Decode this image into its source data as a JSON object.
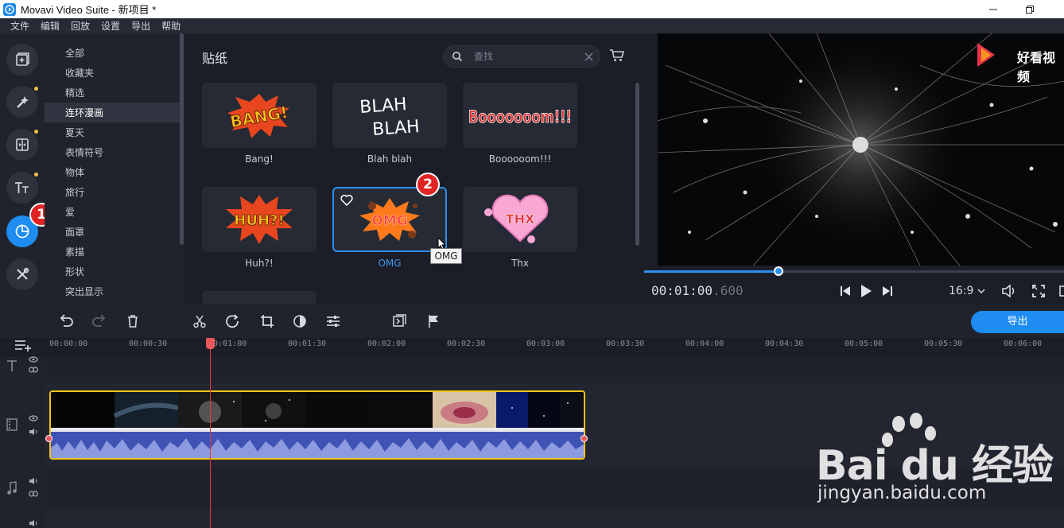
{
  "window": {
    "title": "Movavi Video Suite - 新项目 *",
    "app_icon": "movavi-app-icon",
    "controls": [
      "minimize",
      "restore"
    ]
  },
  "menu": [
    "文件",
    "编辑",
    "回放",
    "设置",
    "导出",
    "帮助"
  ],
  "rail": {
    "buttons": [
      {
        "icon": "import-icon"
      },
      {
        "icon": "magic-wand-icon",
        "dot": true
      },
      {
        "icon": "transitions-icon",
        "dot": true
      },
      {
        "icon": "titles-icon",
        "dot": true
      },
      {
        "icon": "stickers-icon",
        "active": true,
        "badge": "1"
      },
      {
        "icon": "tools-icon"
      }
    ]
  },
  "categories": {
    "items": [
      "全部",
      "收藏夹",
      "精选",
      "连环漫画",
      "夏天",
      "表情符号",
      "物体",
      "旅行",
      "爱",
      "面罩",
      "素描",
      "形状",
      "突出显示"
    ],
    "selected": "连环漫画"
  },
  "gallery": {
    "title": "贴纸",
    "search_placeholder": "查找",
    "stickers": [
      {
        "label": "Bang!",
        "art": "BANG!",
        "color": "#f5c518"
      },
      {
        "label": "Blah blah",
        "art": "BLAH BLAH",
        "color": "#ffffff"
      },
      {
        "label": "Boooooom!!!",
        "art": "Booooooom!!!",
        "color": "#e03131"
      },
      {
        "label": "Huh?!",
        "art": "HUH?!",
        "color": "#f5c518"
      },
      {
        "label": "OMG",
        "art": "OMG",
        "color": "#ff6b2c",
        "selected": true,
        "badge": "2"
      },
      {
        "label": "Thx",
        "art": "THX",
        "color": "#f9a8d4"
      }
    ],
    "tooltip": "OMG"
  },
  "preview": {
    "logo": "好看视频",
    "timecode_main": "00:01:00",
    "timecode_ms": ".600",
    "progress": 0.32,
    "aspect": "16:9"
  },
  "toolbar": {
    "export_label": "导出"
  },
  "timeline": {
    "ticks": [
      "00:00:00",
      "00:00:30",
      "00:01:00",
      "00:01:30",
      "00:02:00",
      "00:02:30",
      "00:03:00",
      "00:03:30",
      "00:04:00",
      "00:04:30",
      "00:05:00",
      "00:05:30",
      "00:06:00"
    ]
  },
  "watermark": {
    "main": "Bai du 经验",
    "url": "jingyan.baidu.com"
  }
}
